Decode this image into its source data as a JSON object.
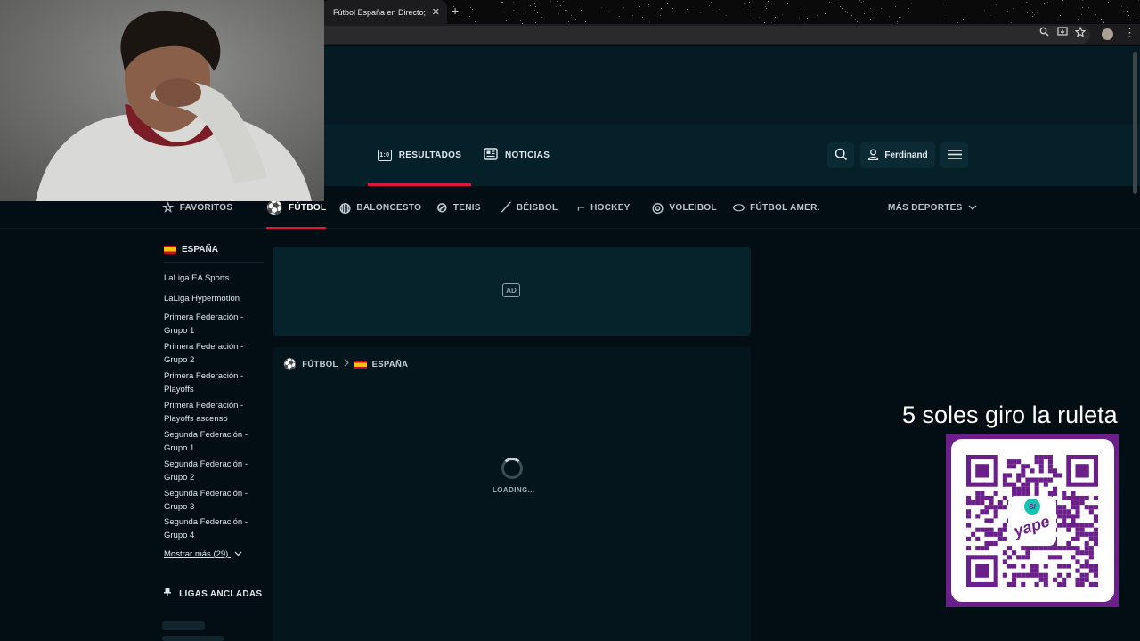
{
  "browser": {
    "tab_title": "Fútbol España en Directo; en ·",
    "tab_close": "✕",
    "new_tab": "+",
    "toolbar_icons": [
      "zoom-icon",
      "install-icon",
      "bookmark-star-icon",
      "profile-avatar",
      "kebab-menu-icon"
    ]
  },
  "header": {
    "tabs": [
      {
        "label": "RESULTADOS",
        "icon": "scoreboard-icon",
        "icon_text": "1:0",
        "active": true
      },
      {
        "label": "NOTICIAS",
        "icon": "newspaper-icon",
        "active": false
      }
    ],
    "user_name": "Ferdinand"
  },
  "sports_nav": {
    "favorites": "FAVORITOS",
    "items": [
      {
        "label": "FÚTBOL",
        "icon": "soccer-ball-icon",
        "active": true
      },
      {
        "label": "BALONCESTO",
        "icon": "basketball-icon"
      },
      {
        "label": "TENIS",
        "icon": "tennis-icon"
      },
      {
        "label": "BÉISBOL",
        "icon": "baseball-icon"
      },
      {
        "label": "HOCKEY",
        "icon": "hockey-icon"
      },
      {
        "label": "VOLEIBOL",
        "icon": "volleyball-icon"
      },
      {
        "label": "FÚTBOL AMER.",
        "icon": "american-football-icon"
      }
    ],
    "more_sports": "MÁS DEPORTES"
  },
  "sidebar": {
    "country": "ESPAÑA",
    "leagues": [
      {
        "line1": "LaLiga EA Sports",
        "line2": ""
      },
      {
        "line1": "LaLiga Hypermotion",
        "line2": ""
      },
      {
        "line1": "Primera Federación -",
        "line2": "Grupo 1"
      },
      {
        "line1": "Primera Federación -",
        "line2": "Grupo 2"
      },
      {
        "line1": "Primera Federación -",
        "line2": "Playoffs"
      },
      {
        "line1": "Primera Federación -",
        "line2": "Playoffs ascenso"
      },
      {
        "line1": "Segunda Federación -",
        "line2": "Grupo 1"
      },
      {
        "line1": "Segunda Federación -",
        "line2": "Grupo 2"
      },
      {
        "line1": "Segunda Federación -",
        "line2": "Grupo 3"
      },
      {
        "line1": "Segunda Federación -",
        "line2": "Grupo 4"
      }
    ],
    "show_more": "Mostrar más (29)",
    "pinned_title": "LIGAS ANCLADAS"
  },
  "main": {
    "ad_label": "AD",
    "breadcrumb": {
      "sport": "FÚTBOL",
      "country": "ESPAÑA"
    },
    "loading": "LOADING..."
  },
  "overlay": {
    "promo_text": "5 soles giro la ruleta",
    "qr_brand": "yape",
    "qr_currency": "S/",
    "qr_frame_color": "#6b1f8a"
  },
  "colors": {
    "accent": "#e3163a",
    "background": "#030d14",
    "nav_background": "#062029"
  }
}
